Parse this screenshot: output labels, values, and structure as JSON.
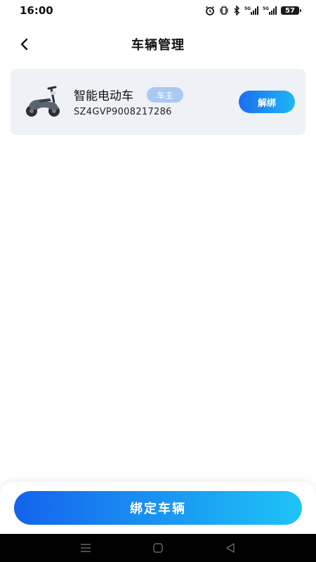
{
  "status_bar": {
    "time": "16:00",
    "battery": "57",
    "icons": [
      "alarm-icon",
      "vibrate-icon",
      "bluetooth-icon",
      "signal-5g-icon",
      "signal-5g-icon",
      "battery-icon"
    ]
  },
  "header": {
    "title": "车辆管理",
    "back_icon": "chevron-left-icon"
  },
  "vehicles": [
    {
      "name": "智能电动车",
      "badge": "车主",
      "id": "SZ4GVP9008217286",
      "action_label": "解绑",
      "image": "scooter-image"
    }
  ],
  "footer": {
    "bind_label": "绑定车辆"
  },
  "system_nav": {
    "icons": [
      "menu-icon",
      "home-icon",
      "back-triangle-icon"
    ]
  },
  "colors": {
    "accent_start": "#1b6cf2",
    "accent_end": "#1fb7f5",
    "card_bg": "#eef1f5",
    "badge_bg": "#a9c9f2"
  }
}
